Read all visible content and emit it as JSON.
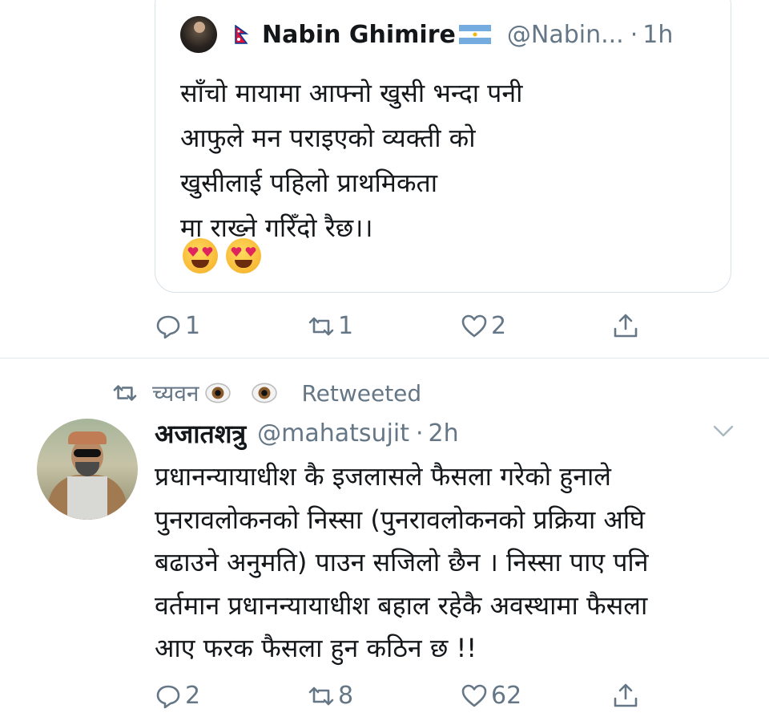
{
  "quoted_tweet": {
    "display_name": "Nabin Ghimire",
    "handle": "@Nabin...",
    "separator": "·",
    "time": "1h",
    "lines": [
      "साँचो मायामा आफ्नो खुसी भन्दा पनी",
      "आफुले मन पराइएको व्यक्ती को",
      "खुसीलाई पहिलो प्राथमिकता",
      "मा राख्ने गरिँदो रैछ।।"
    ],
    "emojis": [
      "smiling-face-with-heart-eyes",
      "smiling-face-with-heart-eyes"
    ]
  },
  "tweet1_actions": {
    "reply_count": "1",
    "retweet_count": "1",
    "like_count": "2"
  },
  "retweet_banner": {
    "retweeter": "च्यवन",
    "emojis": [
      "eye",
      "eye"
    ],
    "label": "Retweeted"
  },
  "tweet2": {
    "display_name": "अजातशत्रु",
    "handle": "@mahatsujit",
    "separator": "·",
    "time": "2h",
    "lines": [
      "प्रधानन्यायाधीश कै इजलासले फैसला गरेको हुनाले",
      "पुनरावलोकनको निस्सा (पुनरावलोकनको प्रक्रिया अघि",
      "बढाउने अनुमति) पाउन सजिलो छैन । निस्सा पाए पनि",
      "वर्तमान प्रधानन्यायाधीश बहाल रहेकै अवस्थामा फैसला",
      "आए फरक फैसला हुन कठिन छ !!"
    ]
  },
  "tweet2_actions": {
    "reply_count": "2",
    "retweet_count": "8",
    "like_count": "62"
  },
  "colors": {
    "text": "#14171a",
    "secondary": "#657786",
    "border": "#d9e1e8",
    "divider": "#e1e8ed"
  },
  "icons": [
    "reply-icon",
    "retweet-icon",
    "like-icon",
    "share-icon",
    "caret-down-icon",
    "nepal-flag-icon",
    "argentina-flag-icon"
  ]
}
